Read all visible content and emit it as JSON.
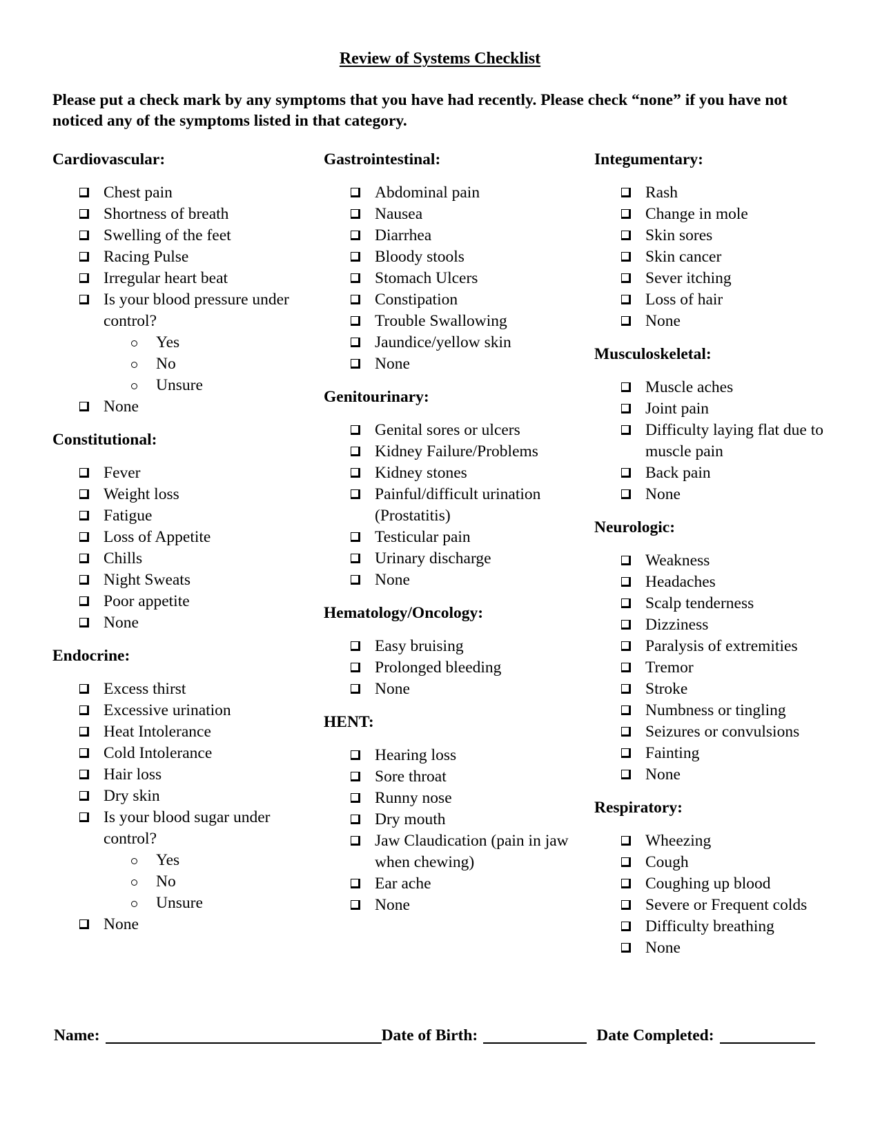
{
  "title": "Review of Systems Checklist",
  "instructions": "Please put a check mark by any symptoms that you have had recently. Please check “none” if you have not noticed any of the symptoms listed in that category.",
  "columns": [
    [
      {
        "header": "Cardiovascular:",
        "items": [
          {
            "label": "Chest pain"
          },
          {
            "label": "Shortness of breath"
          },
          {
            "label": "Swelling of the feet"
          },
          {
            "label": "Racing Pulse"
          },
          {
            "label": "Irregular heart beat"
          },
          {
            "label": "Is your blood pressure under control?",
            "options": [
              "Yes",
              "No",
              "Unsure"
            ]
          },
          {
            "label": "None"
          }
        ]
      },
      {
        "header": "Constitutional:",
        "items": [
          {
            "label": "Fever"
          },
          {
            "label": "Weight loss"
          },
          {
            "label": "Fatigue"
          },
          {
            "label": "Loss of Appetite"
          },
          {
            "label": "Chills"
          },
          {
            "label": "Night Sweats"
          },
          {
            "label": "Poor appetite"
          },
          {
            "label": "None"
          }
        ]
      },
      {
        "header": "Endocrine:",
        "items": [
          {
            "label": "Excess thirst"
          },
          {
            "label": "Excessive urination"
          },
          {
            "label": "Heat Intolerance"
          },
          {
            "label": "Cold Intolerance"
          },
          {
            "label": "Hair loss"
          },
          {
            "label": "Dry skin"
          },
          {
            "label": "Is  your blood sugar under control?",
            "options": [
              "Yes",
              "No",
              "Unsure"
            ]
          },
          {
            "label": "None"
          }
        ]
      }
    ],
    [
      {
        "header": "Gastrointestinal:",
        "items": [
          {
            "label": "Abdominal pain"
          },
          {
            "label": "Nausea"
          },
          {
            "label": "Diarrhea"
          },
          {
            "label": "Bloody stools"
          },
          {
            "label": "Stomach Ulcers"
          },
          {
            "label": "Constipation"
          },
          {
            "label": "Trouble Swallowing"
          },
          {
            "label": "Jaundice/yellow skin"
          },
          {
            "label": "None"
          }
        ]
      },
      {
        "header": "Genitourinary:",
        "items": [
          {
            "label": "Genital sores or ulcers"
          },
          {
            "label": "Kidney Failure/Problems"
          },
          {
            "label": "Kidney stones"
          },
          {
            "label": "Painful/difficult urination (Prostatitis)"
          },
          {
            "label": "Testicular pain"
          },
          {
            "label": "Urinary discharge"
          },
          {
            "label": "None"
          }
        ]
      },
      {
        "header": "Hematology/Oncology:",
        "items": [
          {
            "label": "Easy bruising"
          },
          {
            "label": "Prolonged bleeding"
          },
          {
            "label": "None"
          }
        ]
      },
      {
        "header": "HENT:",
        "items": [
          {
            "label": "Hearing loss"
          },
          {
            "label": "Sore throat"
          },
          {
            "label": "Runny nose"
          },
          {
            "label": "Dry mouth"
          },
          {
            "label": "Jaw Claudication (pain in jaw when chewing)"
          },
          {
            "label": "Ear ache"
          },
          {
            "label": "None"
          }
        ]
      }
    ],
    [
      {
        "header": "Integumentary:",
        "items": [
          {
            "label": "Rash"
          },
          {
            "label": "Change in mole"
          },
          {
            "label": "Skin sores"
          },
          {
            "label": "Skin cancer"
          },
          {
            "label": "Sever itching"
          },
          {
            "label": "Loss of hair"
          },
          {
            "label": "None"
          }
        ]
      },
      {
        "header": "Musculoskeletal:",
        "items": [
          {
            "label": "Muscle aches"
          },
          {
            "label": "Joint pain"
          },
          {
            "label": "Difficulty laying flat due to muscle pain"
          },
          {
            "label": "Back pain"
          },
          {
            "label": "None"
          }
        ]
      },
      {
        "header": "Neurologic:",
        "items": [
          {
            "label": "Weakness"
          },
          {
            "label": "Headaches"
          },
          {
            "label": "Scalp tenderness"
          },
          {
            "label": "Dizziness"
          },
          {
            "label": "Paralysis of extremities"
          },
          {
            "label": "Tremor"
          },
          {
            "label": "Stroke"
          },
          {
            "label": "Numbness or tingling"
          },
          {
            "label": "Seizures or convulsions"
          },
          {
            "label": "Fainting"
          },
          {
            "label": "None"
          }
        ]
      },
      {
        "header": "Respiratory:",
        "items": [
          {
            "label": "Wheezing"
          },
          {
            "label": "Cough"
          },
          {
            "label": "Coughing up blood"
          },
          {
            "label": "Severe or Frequent colds"
          },
          {
            "label": "Difficulty breathing"
          },
          {
            "label": "None"
          }
        ]
      }
    ]
  ],
  "footer": {
    "name_label": "Name:",
    "name_value": "",
    "dob_label": "Date of Birth:",
    "dob_value": "",
    "date_completed_label": "Date Completed:",
    "date_completed_value": ""
  },
  "icons": {
    "checkbox": "shadowed-checkbox-icon",
    "radio": "hollow-circle-bullet-icon"
  }
}
